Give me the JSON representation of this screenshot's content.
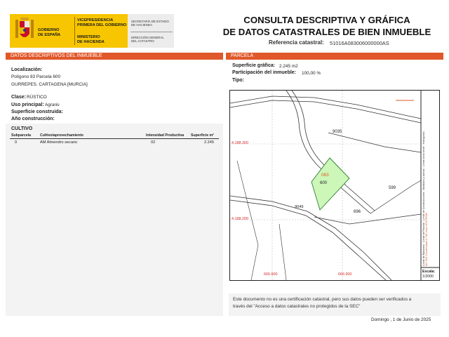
{
  "header": {
    "vicepresidencia": "VICEPRESIDENCIA",
    "primera_del_gobierno": "PRIMERA DEL GOBIERNO",
    "gobierno": "GOBIERNO",
    "de_espana": "DE ESPAÑA",
    "ministerio": "MINISTERIO",
    "de_hacienda": "DE HACIENDA",
    "secretaria_1": "SECRETARÍA DE ESTADO",
    "secretaria_2": "DE HACIENDA",
    "direccion_1": "DIRECCIÓN GENERAL",
    "direccion_2": "DEL CATASTRO",
    "title_line1": "CONSULTA DESCRIPTIVA Y GRÁFICA",
    "title_line2": "DE DATOS CATASTRALES DE BIEN INMUEBLE",
    "ref_label": "Referencia catastral:",
    "ref_value": "51016A083006000000AS",
    "colors": {
      "brand_yellow": "#f7c600",
      "accent": "#e0582a",
      "parcel_green": "#ccf7b8"
    }
  },
  "left": {
    "section_title": "DATOS DESCRIPTIVOS DEL INMUEBLE",
    "localizacion_label": "Localización:",
    "localizacion_line1": "Polígono 83 Parcela 600",
    "localizacion_line2": "GURREPES. CARTAGENA [MURCIA]",
    "clase_label": "Clase:",
    "clase_value": "RÚSTICO",
    "uso_label": "Uso principal:",
    "uso_value": "Agrario",
    "superficie_construida_label": "Superficie construida:",
    "anio_label": "Año construcción:",
    "cultivo_title": "CULTIVO",
    "cultivo_headers": [
      "Subparcela",
      "Cultivo/aprovechamiento",
      "Intensidad Productiva",
      "Superficie m²"
    ],
    "cultivo_rows": [
      {
        "subparcela": "0",
        "cultivo": "AM Almendro secano",
        "intensidad": "02",
        "superficie": "2.245"
      }
    ]
  },
  "right": {
    "section_title": "PARCELA",
    "superficie_grafica_label": "Superficie gráfica:",
    "superficie_grafica_value": "2.245 m2",
    "participacion_label": "Participación del inmueble:",
    "participacion_value": "100,00 %",
    "tipo_label": "Tipo:"
  },
  "map": {
    "parcel_number_red": "083",
    "parcel_number": "600",
    "labels": {
      "p9035": "9035",
      "p599": "599",
      "p696": "696",
      "p9049": "9049"
    },
    "coords": {
      "y_top": "4.188.300",
      "y_bottom": "4.188.200",
      "x_left": "666.600",
      "x_right": "666.900"
    },
    "legend": [
      "Límite de Manzana",
      "Límite de Parcela",
      "Límite de Construcciones",
      "Mobiliario y aceras",
      "Límite zona verde",
      "Hidrografía"
    ],
    "projection": "667,000 Coordenadas U.T.M. Huso 30 ETRS89",
    "scale_label": "Escala:",
    "scale_value": "1/2000"
  },
  "footer": {
    "notice_line1": "Este documento no es una certificación catastral, pero sus datos pueden ser verificados a",
    "notice_line2": "través del \"Acceso a datos catastrales no protegidos de la SEC\"",
    "date": "Domingo , 1 de Junio de 2025"
  }
}
